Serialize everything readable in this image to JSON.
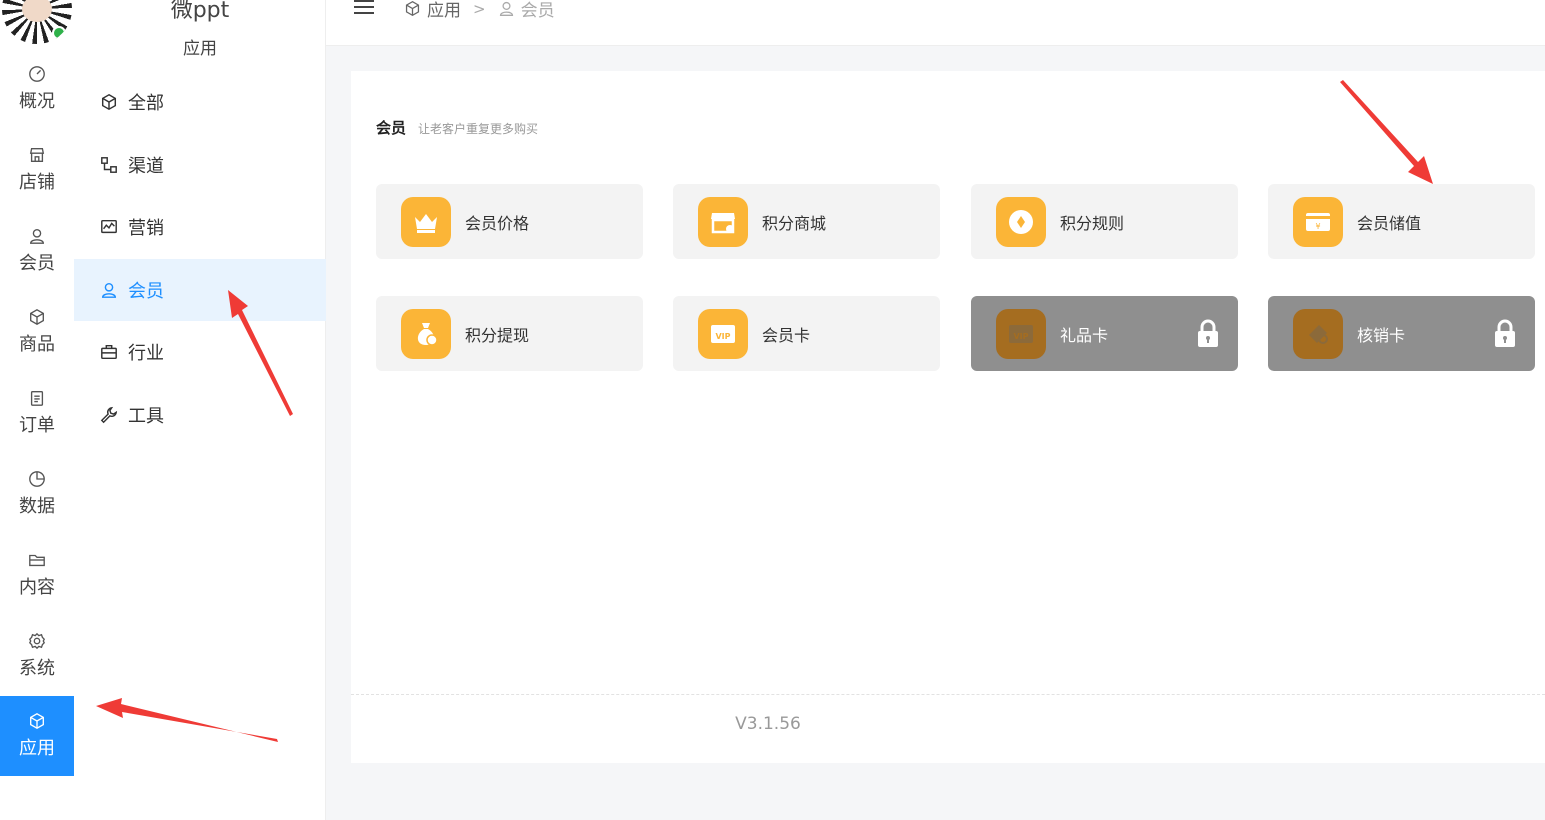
{
  "brand": {
    "title": "微ppt",
    "subtitle": "应用"
  },
  "rail": {
    "items": [
      {
        "label": "概况",
        "icon": "dashboard-icon"
      },
      {
        "label": "店铺",
        "icon": "store-icon"
      },
      {
        "label": "会员",
        "icon": "user-icon"
      },
      {
        "label": "商品",
        "icon": "box-icon"
      },
      {
        "label": "订单",
        "icon": "clipboard-icon"
      },
      {
        "label": "数据",
        "icon": "pie-chart-icon"
      },
      {
        "label": "内容",
        "icon": "folder-icon"
      },
      {
        "label": "系统",
        "icon": "gear-icon"
      },
      {
        "label": "应用",
        "icon": "cube-icon",
        "active": true
      }
    ]
  },
  "submenu": {
    "items": [
      {
        "label": "全部",
        "icon": "cube-icon"
      },
      {
        "label": "渠道",
        "icon": "channel-icon"
      },
      {
        "label": "营销",
        "icon": "trend-icon"
      },
      {
        "label": "会员",
        "icon": "user-icon",
        "active": true
      },
      {
        "label": "行业",
        "icon": "briefcase-icon"
      },
      {
        "label": "工具",
        "icon": "wrench-icon"
      }
    ]
  },
  "breadcrumb": {
    "root": "应用",
    "sep": ">",
    "current": "会员"
  },
  "section": {
    "title": "会员",
    "desc": "让老客户重复更多购买"
  },
  "tiles": [
    {
      "name": "会员价格",
      "icon": "crown-icon",
      "locked": false
    },
    {
      "name": "积分商城",
      "icon": "shop-icon",
      "locked": false
    },
    {
      "name": "积分规则",
      "icon": "coin-icon",
      "locked": false
    },
    {
      "name": "会员储值",
      "icon": "wallet-icon",
      "locked": false
    },
    {
      "name": "积分提现",
      "icon": "money-bag-icon",
      "locked": false
    },
    {
      "name": "会员卡",
      "icon": "vip-card-icon",
      "locked": false
    },
    {
      "name": "礼品卡",
      "icon": "vip-card-icon",
      "locked": true
    },
    {
      "name": "核销卡",
      "icon": "ticket-icon",
      "locked": true
    }
  ],
  "version": "V3.1.56",
  "colors": {
    "accent": "#1e8fff",
    "tile_icon": "#fbb537",
    "locked_bg": "#8f8f8f",
    "annotation": "#ef3b36"
  }
}
